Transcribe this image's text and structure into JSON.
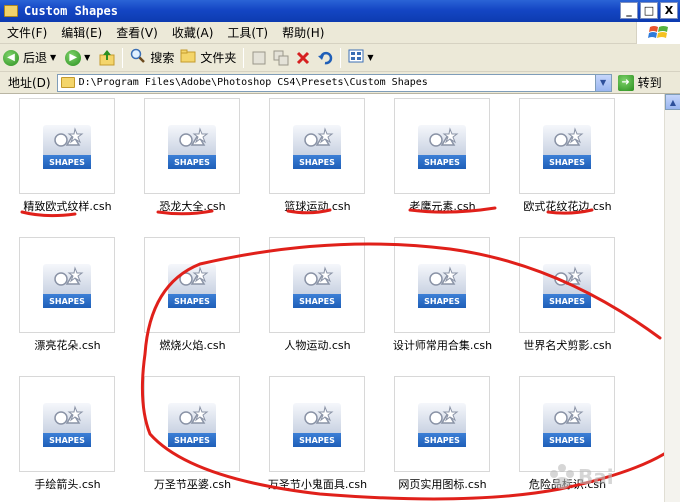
{
  "window": {
    "title": "Custom Shapes",
    "controls": {
      "minimize": "_",
      "maximize": "□",
      "close": "X"
    }
  },
  "menu": {
    "items": [
      "文件(F)",
      "编辑(E)",
      "查看(V)",
      "收藏(A)",
      "工具(T)",
      "帮助(H)"
    ]
  },
  "toolbar": {
    "back_label": "后退",
    "search_label": "搜索",
    "folders_label": "文件夹"
  },
  "address": {
    "label": "地址(D)",
    "path": "D:\\Program Files\\Adobe\\Photoshop CS4\\Presets\\Custom Shapes",
    "go_label": "转到"
  },
  "files": [
    {
      "name": "精致欧式纹样.csh",
      "icon": "shapes-file-icon",
      "thumb_label": "SHAPES"
    },
    {
      "name": "恐龙大全.csh",
      "icon": "shapes-file-icon",
      "thumb_label": "SHAPES"
    },
    {
      "name": "篮球运动.csh",
      "icon": "shapes-file-icon",
      "thumb_label": "SHAPES"
    },
    {
      "name": "老鹰元素.csh",
      "icon": "shapes-file-icon",
      "thumb_label": "SHAPES"
    },
    {
      "name": "欧式花纹花边.csh",
      "icon": "shapes-file-icon",
      "thumb_label": "SHAPES"
    },
    {
      "name": "漂亮花朵.csh",
      "icon": "shapes-file-icon",
      "thumb_label": "SHAPES"
    },
    {
      "name": "燃烧火焰.csh",
      "icon": "shapes-file-icon",
      "thumb_label": "SHAPES"
    },
    {
      "name": "人物运动.csh",
      "icon": "shapes-file-icon",
      "thumb_label": "SHAPES"
    },
    {
      "name": "设计师常用合集.csh",
      "icon": "shapes-file-icon",
      "thumb_label": "SHAPES"
    },
    {
      "name": "世界名犬剪影.csh",
      "icon": "shapes-file-icon",
      "thumb_label": "SHAPES"
    },
    {
      "name": "手绘箭头.csh",
      "icon": "shapes-file-icon",
      "thumb_label": "SHAPES"
    },
    {
      "name": "万圣节巫婆.csh",
      "icon": "shapes-file-icon",
      "thumb_label": "SHAPES"
    },
    {
      "name": "万圣节小鬼面具.csh",
      "icon": "shapes-file-icon",
      "thumb_label": "SHAPES"
    },
    {
      "name": "网页实用图标.csh",
      "icon": "shapes-file-icon",
      "thumb_label": "SHAPES"
    },
    {
      "name": "危险品标识.csh",
      "icon": "shapes-file-icon",
      "thumb_label": "SHAPES"
    }
  ],
  "colors": {
    "annotation": "#e0201a",
    "titlebar": "#1446c4",
    "chrome": "#ece9d8"
  }
}
